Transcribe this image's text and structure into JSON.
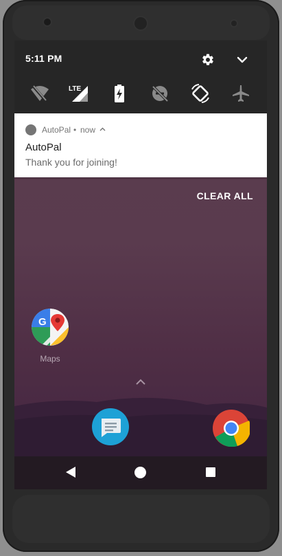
{
  "status_bar": {
    "time": "5:11 PM"
  },
  "quick_settings": {
    "settings_icon": "gear-icon",
    "collapse_icon": "chevron-down-icon",
    "tiles": [
      "wifi-off-icon",
      "lte-signal-icon",
      "battery-charging-icon",
      "do-not-disturb-off-icon",
      "auto-rotate-icon",
      "airplane-mode-icon"
    ],
    "lte_label": "LTE"
  },
  "notification": {
    "app_name": "AutoPal",
    "separator": "•",
    "time": "now",
    "title": "AutoPal",
    "body": "Thank you for joining!"
  },
  "shade": {
    "clear_all_label": "CLEAR ALL"
  },
  "home": {
    "apps": [
      {
        "label": "Maps",
        "icon": "maps-icon"
      }
    ],
    "dock": [
      "messages-icon",
      "chrome-icon"
    ]
  },
  "colors": {
    "quick_settings_bg": "#262626",
    "notification_bg": "#ffffff",
    "wallpaper_top": "#5b3d4e",
    "wallpaper_bottom": "#3f2340"
  }
}
